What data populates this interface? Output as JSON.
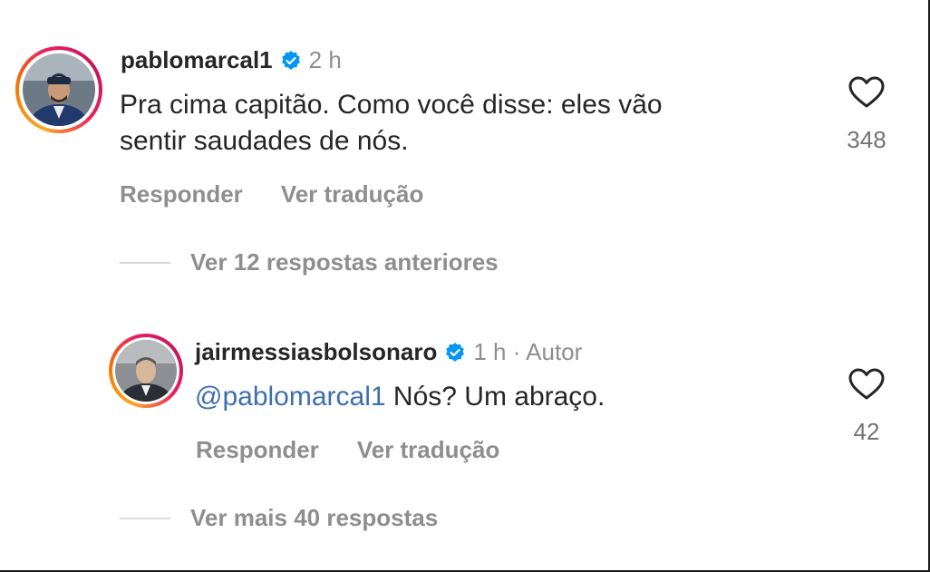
{
  "comments": [
    {
      "username": "pablomarcal1",
      "time": "2 h",
      "text": "Pra cima capitão. Como você disse: eles vão sentir saudades de nós.",
      "text_line1": "Pra cima capitão. Como você disse: eles vão",
      "text_line2": "sentir saudades de nós.",
      "reply_label": "Responder",
      "translate_label": "Ver tradução",
      "likes": "348",
      "avatar_icon": "profile-photo"
    },
    {
      "username": "jairmessiasbolsonaro",
      "time": "1 h · Autor",
      "mention": "@pablomarcal1",
      "text": "Nós? Um abraço.",
      "reply_label": "Responder",
      "translate_label": "Ver tradução",
      "likes": "42",
      "avatar_icon": "profile-photo"
    }
  ],
  "previous_replies_label": "Ver 12 respostas anteriores",
  "more_replies_label": "Ver mais 40 respostas",
  "icons": {
    "verified": "verified-badge-icon",
    "like": "heart-icon"
  },
  "colors": {
    "verified": "#0095f6",
    "mention": "#3d6fb0",
    "secondary_text": "#8e8e8e",
    "primary_text": "#262626"
  }
}
